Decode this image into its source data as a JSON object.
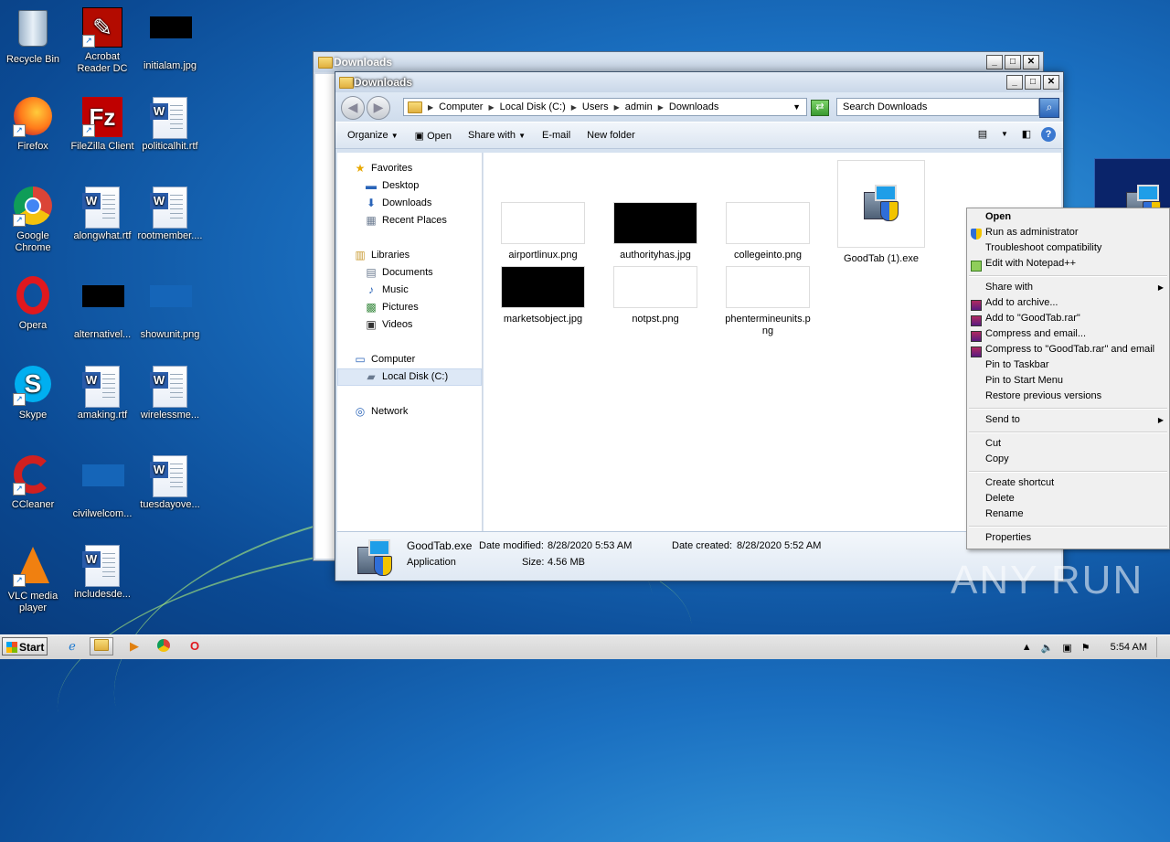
{
  "desktop": {
    "icons": [
      {
        "label": "Recycle Bin"
      },
      {
        "label": "Acrobat Reader DC"
      },
      {
        "label": "initialam.jpg"
      },
      {
        "label": "Firefox"
      },
      {
        "label": "FileZilla Client"
      },
      {
        "label": "politicalhit.rtf"
      },
      {
        "label": "Google Chrome"
      },
      {
        "label": "alongwhat.rtf"
      },
      {
        "label": "rootmember...."
      },
      {
        "label": "Opera"
      },
      {
        "label": "alternativel..."
      },
      {
        "label": "showunit.png"
      },
      {
        "label": "Skype"
      },
      {
        "label": "amaking.rtf"
      },
      {
        "label": "wirelessme..."
      },
      {
        "label": "CCleaner"
      },
      {
        "label": "civilwelcom..."
      },
      {
        "label": "tuesdayove..."
      },
      {
        "label": "VLC media player"
      },
      {
        "label": "includesde..."
      }
    ]
  },
  "back_window": {
    "title": "Downloads"
  },
  "window": {
    "title": "Downloads",
    "breadcrumbs": [
      "Computer",
      "Local Disk (C:)",
      "Users",
      "admin",
      "Downloads"
    ],
    "search_placeholder": "Search Downloads",
    "toolbar": {
      "organize": "Organize",
      "open": "Open",
      "share_with": "Share with",
      "email": "E-mail",
      "new_folder": "New folder"
    },
    "nav": {
      "favorites": "Favorites",
      "desktop": "Desktop",
      "downloads": "Downloads",
      "recent_places": "Recent Places",
      "libraries": "Libraries",
      "documents": "Documents",
      "music": "Music",
      "pictures": "Pictures",
      "videos": "Videos",
      "computer": "Computer",
      "local_disk": "Local Disk (C:)",
      "network": "Network"
    },
    "files": [
      {
        "name": "airportlinux.png"
      },
      {
        "name": "authorityhas.jpg"
      },
      {
        "name": "collegeinto.png"
      },
      {
        "name": "GoodTab (1).exe"
      },
      {
        "name": "marketsobject.jpg"
      },
      {
        "name": "notpst.png"
      },
      {
        "name": "phentermineunits.png"
      }
    ],
    "details": {
      "name": "GoodTab.exe",
      "type": "Application",
      "modified_label": "Date modified:",
      "modified_value": "8/28/2020 5:53 AM",
      "created_label": "Date created:",
      "created_value": "8/28/2020 5:52 AM",
      "size_label": "Size:",
      "size_value": "4.56 MB"
    }
  },
  "context_menu": {
    "open": "Open",
    "run_as_admin": "Run as administrator",
    "troubleshoot": "Troubleshoot compatibility",
    "edit_notepad": "Edit with Notepad++",
    "share_with": "Share with",
    "add_archive": "Add to archive...",
    "add_rar": "Add to \"GoodTab.rar\"",
    "compress_email": "Compress and email...",
    "compress_rar_email": "Compress to \"GoodTab.rar\" and email",
    "pin_taskbar": "Pin to Taskbar",
    "pin_start": "Pin to Start Menu",
    "restore_versions": "Restore previous versions",
    "send_to": "Send to",
    "cut": "Cut",
    "copy": "Copy",
    "create_shortcut": "Create shortcut",
    "delete": "Delete",
    "rename": "Rename",
    "properties": "Properties"
  },
  "taskbar": {
    "start": "Start",
    "clock": "5:54 AM"
  },
  "watermark": "ANY RUN"
}
